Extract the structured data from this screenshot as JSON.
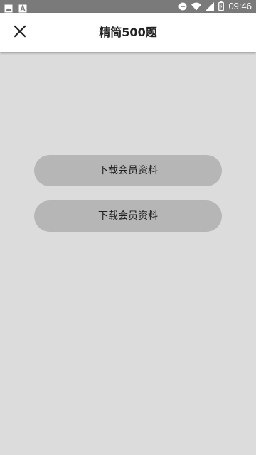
{
  "status_bar": {
    "time": "09:46",
    "left_icons": [
      "image-icon",
      "text-a-icon"
    ],
    "right_icons": [
      "do-not-disturb-icon",
      "wifi-icon",
      "cellular-signal-icon",
      "battery-icon"
    ],
    "background": "#7a7a7a"
  },
  "header": {
    "title": "精简500题",
    "close_icon": "close-icon",
    "background": "#ffffff"
  },
  "main": {
    "background": "#dcdcdc",
    "buttons": [
      {
        "label": "下载会员资料"
      },
      {
        "label": "下载会员资料"
      }
    ],
    "button_color": "#b6b6b6"
  }
}
